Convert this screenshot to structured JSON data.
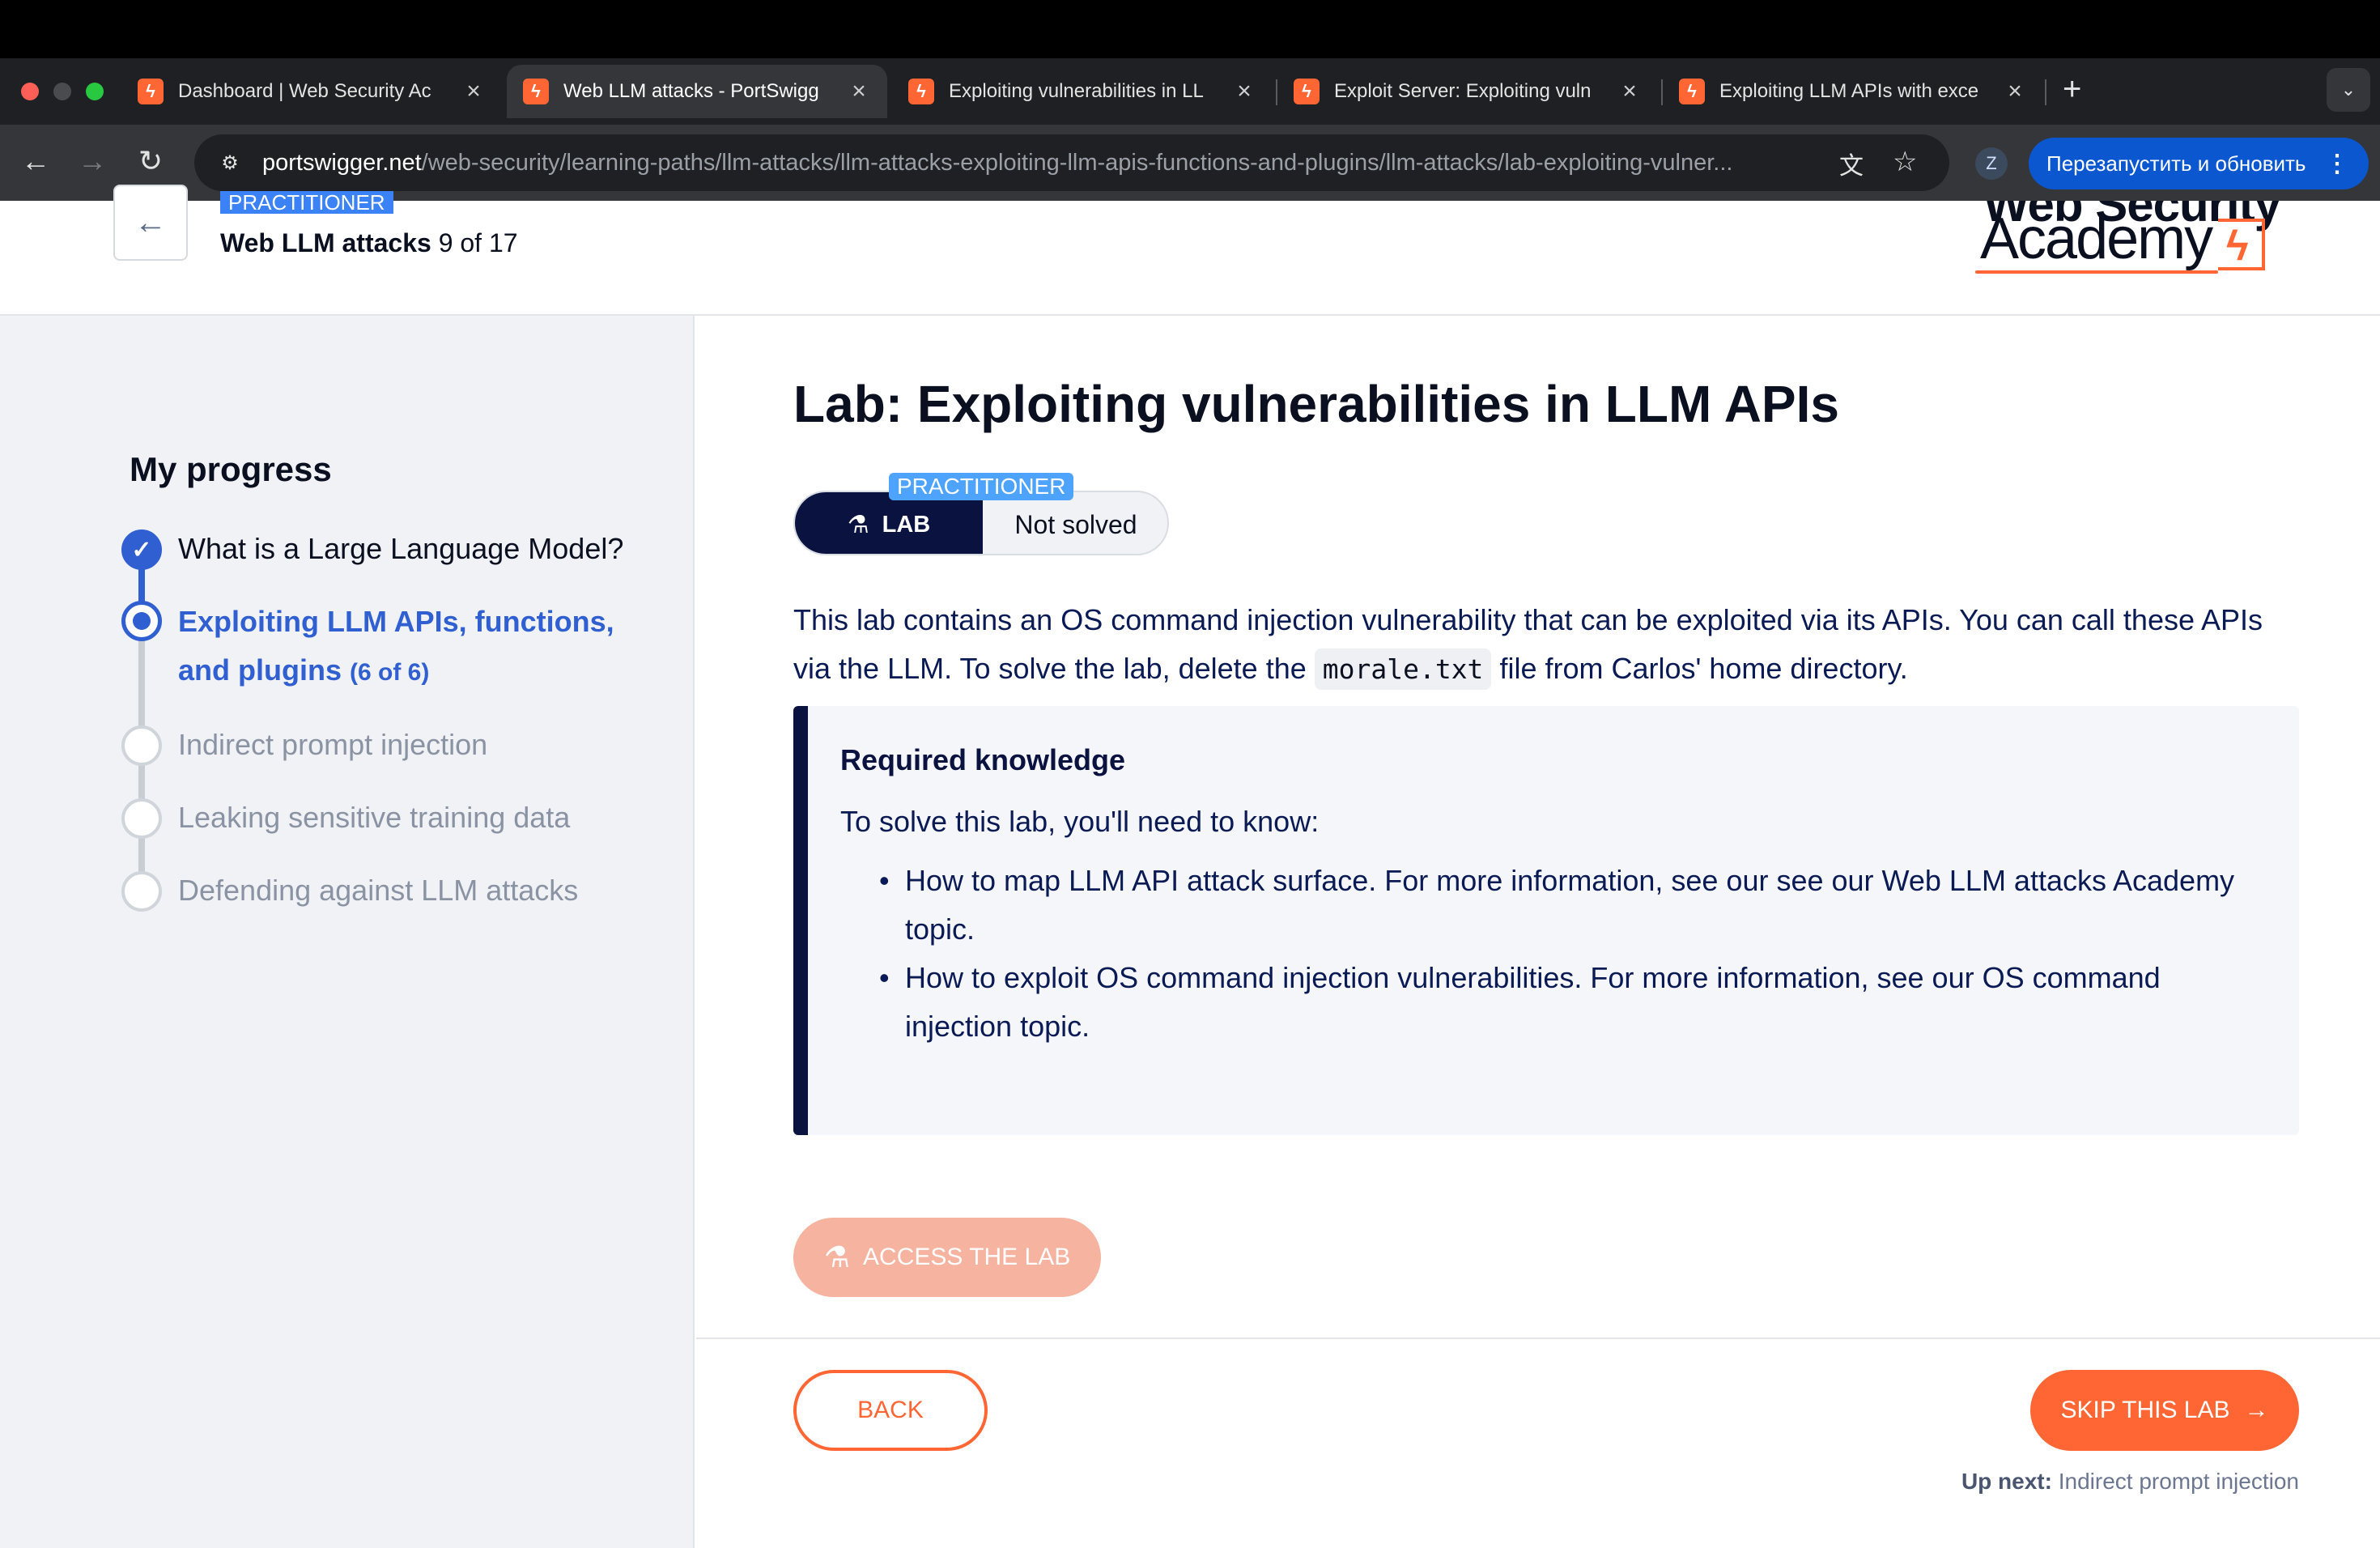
{
  "browser": {
    "tabs": [
      {
        "title": "Dashboard | Web Security Ac"
      },
      {
        "title": "Web LLM attacks - PortSwigg"
      },
      {
        "title": "Exploiting vulnerabilities in LL"
      },
      {
        "title": "Exploit Server: Exploiting vuln"
      },
      {
        "title": "Exploiting LLM APIs with exce"
      }
    ],
    "url_host": "portswigger.net",
    "url_path": "/web-security/learning-paths/llm-attacks/llm-attacks-exploiting-llm-apis-functions-and-plugins/llm-attacks/lab-exploiting-vulner...",
    "profile_initial": "Z",
    "relaunch_label": "Перезапустить и обновить"
  },
  "header": {
    "level_chip": "PRACTITIONER",
    "path_title": "Web LLM attacks",
    "path_progress": "9 of 17",
    "logo_top": "Web Security",
    "logo_bottom": "Academy"
  },
  "sidebar": {
    "title": "My progress",
    "steps": [
      {
        "label": "What is a Large Language Model?",
        "state": "done"
      },
      {
        "label": "Exploiting LLM APIs, functions, and plugins",
        "count": "(6 of 6)",
        "state": "current"
      },
      {
        "label": "Indirect prompt injection",
        "state": "todo"
      },
      {
        "label": "Leaking sensitive training data",
        "state": "todo"
      },
      {
        "label": "Defending against LLM attacks",
        "state": "todo"
      }
    ]
  },
  "main": {
    "title": "Lab: Exploiting vulnerabilities in LLM APIs",
    "level_badge": "PRACTITIONER",
    "lab_label": "LAB",
    "status": "Not solved",
    "desc_1": "This lab contains an OS command injection vulnerability that can be exploited via its APIs. You can call these APIs via the LLM. To solve the lab, delete the ",
    "desc_code": "morale.txt",
    "desc_2": " file from Carlos' home directory.",
    "knowledge": {
      "title": "Required knowledge",
      "intro": "To solve this lab, you'll need to know:",
      "items": [
        "How to map LLM API attack surface. For more information, see our see our Web LLM attacks Academy topic.",
        "How to exploit OS command injection vulnerabilities. For more information, see our OS command injection topic."
      ]
    },
    "access_label": "ACCESS THE LAB",
    "back_label": "BACK",
    "skip_label": "SKIP THIS LAB",
    "upnext_label": "Up next:",
    "upnext_value": "Indirect prompt injection"
  },
  "colors": {
    "accent": "#ff6633",
    "navy": "#0a1240",
    "progress_blue": "#2f5fd0"
  }
}
